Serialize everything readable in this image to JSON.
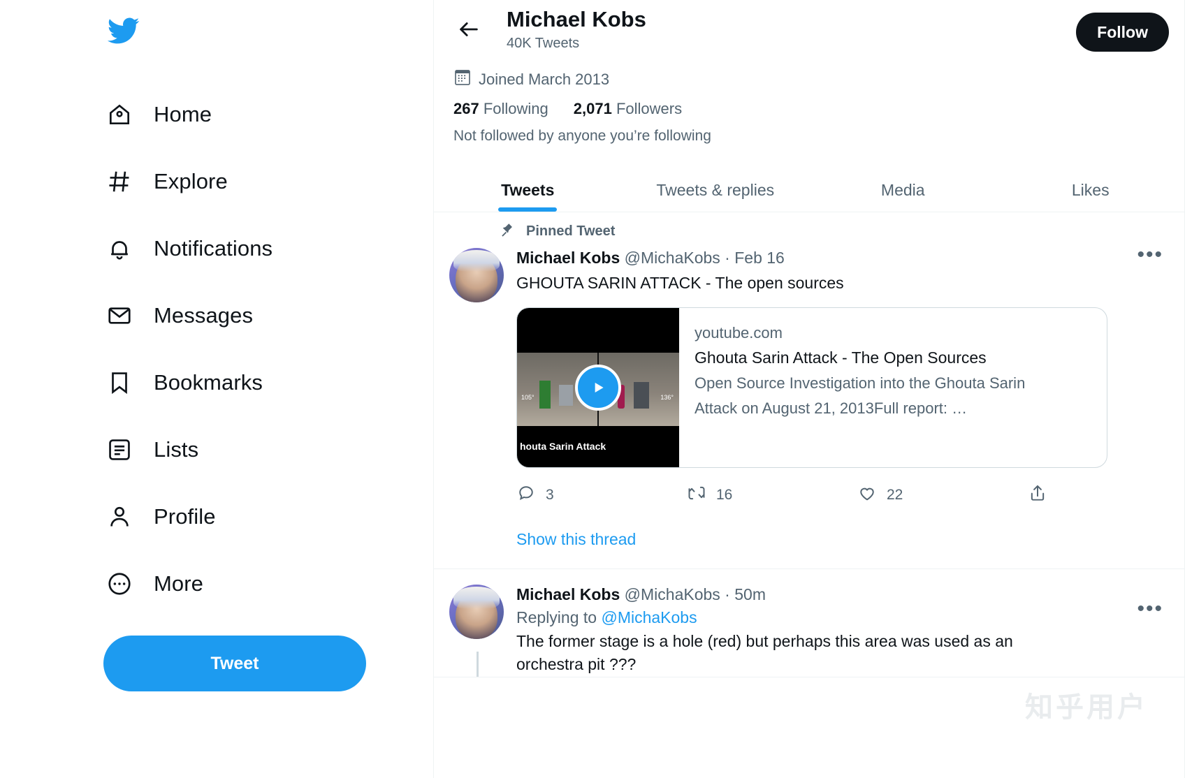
{
  "sidebar": {
    "logo": "twitter-bird-logo",
    "items": [
      {
        "label": "Home",
        "icon": "home-icon"
      },
      {
        "label": "Explore",
        "icon": "hashtag-icon"
      },
      {
        "label": "Notifications",
        "icon": "bell-icon"
      },
      {
        "label": "Messages",
        "icon": "envelope-icon"
      },
      {
        "label": "Bookmarks",
        "icon": "bookmark-icon"
      },
      {
        "label": "Lists",
        "icon": "list-icon"
      },
      {
        "label": "Profile",
        "icon": "person-icon"
      },
      {
        "label": "More",
        "icon": "more-circle-icon"
      }
    ],
    "tweet_button": "Tweet",
    "accent_color": "#1d9bf0"
  },
  "header": {
    "back_icon": "arrow-left-icon",
    "name": "Michael Kobs",
    "tweet_count": "40K Tweets",
    "follow_button": "Follow",
    "follow_button_color": "#0f1419"
  },
  "profile": {
    "joined_icon": "calendar-icon",
    "joined": "Joined March 2013",
    "following_count": "267",
    "following_label": "Following",
    "followers_count": "2,071",
    "followers_label": "Followers",
    "not_followed": "Not followed by anyone you’re following"
  },
  "tabs": [
    {
      "label": "Tweets",
      "active": true
    },
    {
      "label": "Tweets & replies",
      "active": false
    },
    {
      "label": "Media",
      "active": false
    },
    {
      "label": "Likes",
      "active": false
    }
  ],
  "tweets": [
    {
      "pinned_label": "Pinned Tweet",
      "pin_icon": "pin-icon",
      "author": "Michael Kobs",
      "handle": "@MichaKobs",
      "separator": "·",
      "time": "Feb 16",
      "text": "GHOUTA SARIN ATTACK - The open sources",
      "more_icon": "more-horizontal-icon",
      "card": {
        "domain": "youtube.com",
        "title": "Ghouta Sarin Attack - The Open Sources",
        "description_line1": "Open Source Investigation into the Ghouta Sarin",
        "description_line2": "Attack on August 21, 2013Full report: …",
        "thumb_caption": "houta Sarin Attack",
        "thumb_label_left": "105°",
        "thumb_label_right": "136°",
        "play_icon": "play-icon"
      },
      "actions": {
        "reply_icon": "reply-icon",
        "reply_count": "3",
        "retweet_icon": "retweet-icon",
        "retweet_count": "16",
        "like_icon": "heart-icon",
        "like_count": "22",
        "share_icon": "share-icon"
      },
      "show_thread": "Show this thread"
    },
    {
      "author": "Michael Kobs",
      "handle": "@MichaKobs",
      "separator": "·",
      "time": "50m",
      "replying_prefix": "Replying to",
      "replying_mention": "@MichaKobs",
      "text_line1": "The former stage is a hole (red) but perhaps this area was used as an",
      "text_line2": "orchestra pit ???",
      "more_icon": "more-horizontal-icon"
    }
  ],
  "watermark": "知乎用户"
}
